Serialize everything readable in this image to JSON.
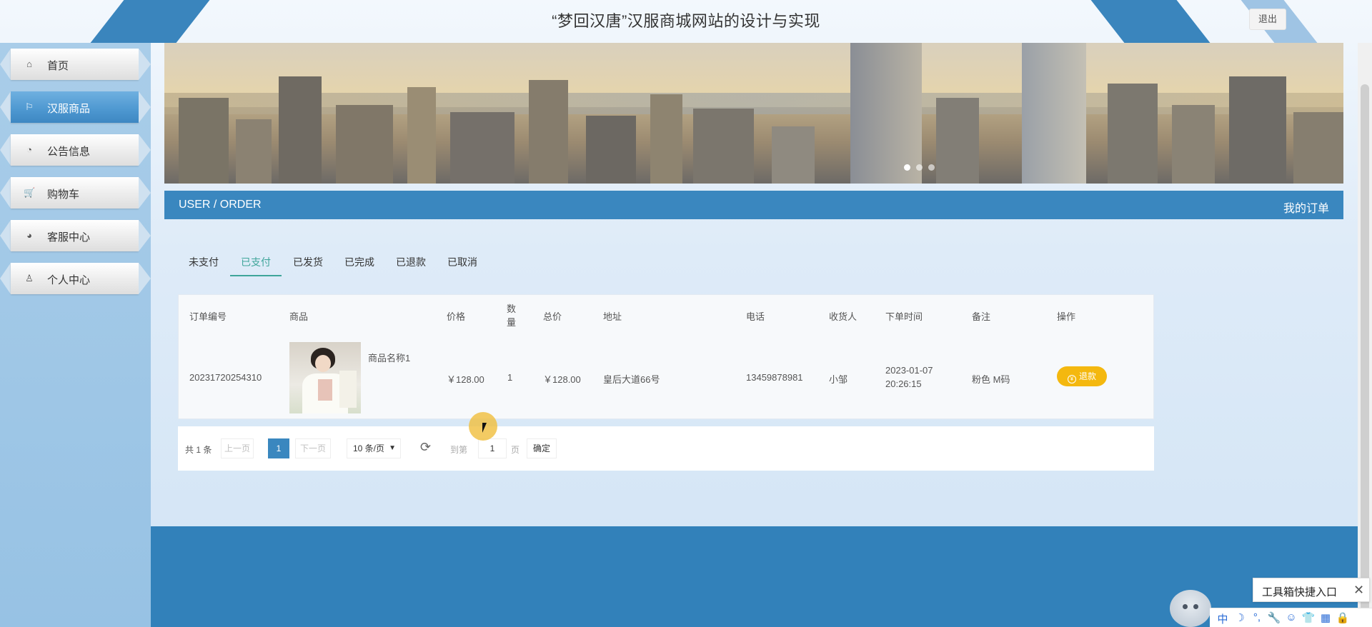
{
  "header": {
    "site_title": "“梦回汉唐”汉服商城网站的设计与实现",
    "logout_label": "退出"
  },
  "sidebar": {
    "items": [
      {
        "label": "首页",
        "icon": "home-icon"
      },
      {
        "label": "汉服商品",
        "icon": "flag-icon",
        "active": true
      },
      {
        "label": "公告信息",
        "icon": "gauge-icon"
      },
      {
        "label": "购物车",
        "icon": "cart-icon"
      },
      {
        "label": "客服中心",
        "icon": "support-icon"
      },
      {
        "label": "个人中心",
        "icon": "user-icon"
      }
    ]
  },
  "banner": {
    "dots_total": 3,
    "active_dot": 1
  },
  "section": {
    "left_title": "USER / ORDER",
    "right_title": "我的订单"
  },
  "tabs": [
    "未支付",
    "已支付",
    "已发货",
    "已完成",
    "已退款",
    "已取消"
  ],
  "active_tab": "已支付",
  "table": {
    "headers": {
      "order_no": "订单编号",
      "product": "商品",
      "price": "价格",
      "qty": "数量",
      "total": "总价",
      "address": "地址",
      "phone": "电话",
      "receiver": "收货人",
      "order_time": "下单时间",
      "remark": "备注",
      "action": "操作"
    },
    "rows": [
      {
        "order_no": "20231720254310",
        "product_name": "商品名称1",
        "price": "￥128.00",
        "qty": "1",
        "total": "￥128.00",
        "address": "皇后大道66号",
        "phone": "13459878981",
        "receiver": "小邹",
        "order_date": "2023-01-07",
        "order_clock": "20:26:15",
        "remark": "粉色 M码",
        "action_label": "退款"
      }
    ]
  },
  "pager": {
    "total": "共 1 条",
    "prev": "上一页",
    "current": "1",
    "next": "下一页",
    "page_size": "10 条/页",
    "goto_label": "到第",
    "goto_value": "1",
    "page_unit": "页",
    "confirm": "确定"
  },
  "toolbox": {
    "label": "工具箱快捷入口",
    "close": "✕"
  },
  "ime": [
    "中",
    "☽",
    "°,",
    "🔧",
    "☺",
    "👕",
    "▦",
    "🔒"
  ],
  "colors": {
    "primary": "#3a87bf",
    "active_tab": "#3fa59a",
    "refund_button": "#f4b80f",
    "footer": "#3281ba"
  }
}
